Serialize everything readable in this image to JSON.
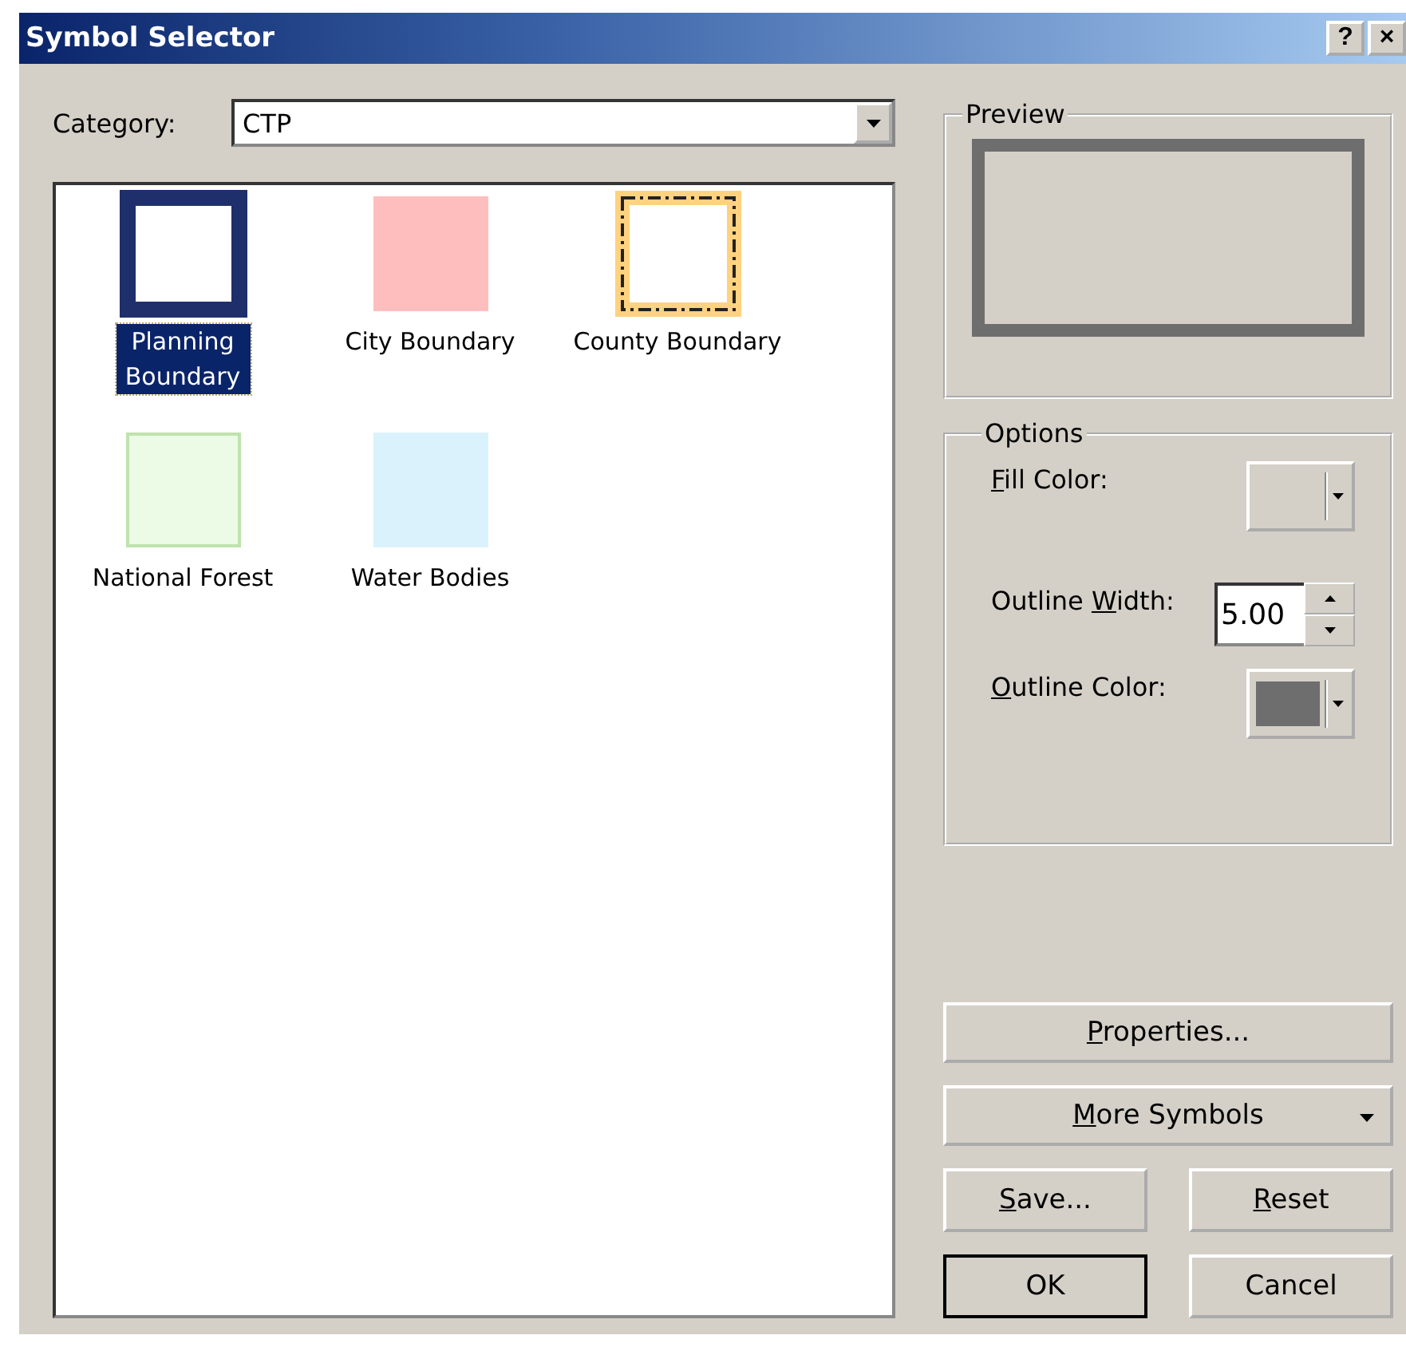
{
  "window": {
    "title": "Symbol Selector",
    "buttons": [
      "?",
      "×"
    ]
  },
  "category": {
    "label": "Category:",
    "value": "CTP"
  },
  "symbols": [
    {
      "label": "Planning Boundary",
      "kind": "hatched_outline",
      "color": "#1f2f6b",
      "selected": true
    },
    {
      "label": "City Boundary",
      "kind": "fill",
      "color": "#ffbebe",
      "selected": false
    },
    {
      "label": "County Boundary",
      "kind": "dashed_outline",
      "color": "#ffd27f",
      "selected": false
    },
    {
      "label": "National Forest",
      "kind": "fill_outlined",
      "color": "#ebfbe6",
      "selected": false
    },
    {
      "label": "Water Bodies",
      "kind": "fill",
      "color": "#daf2fc",
      "selected": false
    }
  ],
  "preview": {
    "title": "Preview"
  },
  "options": {
    "title": "Options",
    "fill_color": {
      "label": {
        "key": "F",
        "after": "ill Color:"
      }
    },
    "outline_width": {
      "label": {
        "before": "Outline ",
        "key": "W",
        "after": "idth:"
      },
      "value": "5.00"
    },
    "outline_color": {
      "label": {
        "key": "O",
        "after": "utline Color:"
      },
      "color": "#6e6e6e"
    }
  },
  "buttons": [
    {
      "kind": "wide",
      "label": {
        "key": "P",
        "after": "roperties..."
      },
      "default": false
    },
    {
      "kind": "menu",
      "label": {
        "key": "M",
        "after": "ore Symbols"
      },
      "default": false
    },
    {
      "kind": "half",
      "label": {
        "key": "S",
        "after": "ave..."
      },
      "default": false
    },
    {
      "kind": "half",
      "label": {
        "key": "R",
        "after": "eset"
      },
      "default": false
    },
    {
      "kind": "half",
      "label": {
        "before": "OK"
      },
      "default": true
    },
    {
      "kind": "half",
      "label": {
        "before": "Cancel"
      },
      "default": false
    }
  ]
}
